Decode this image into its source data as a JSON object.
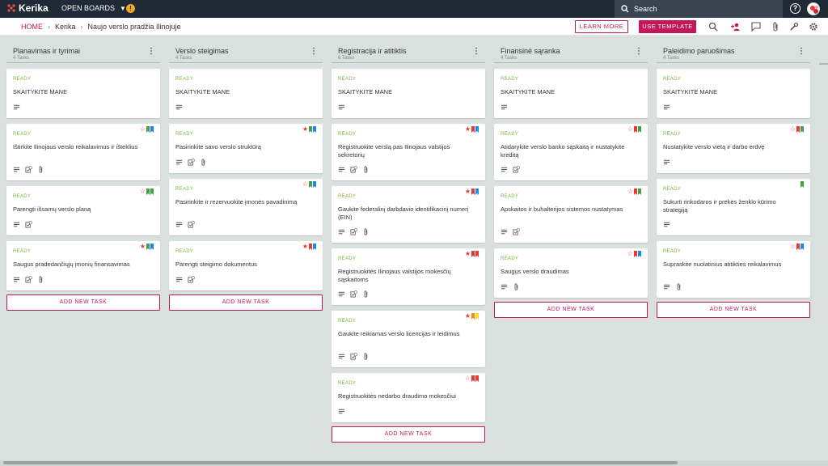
{
  "topbar": {
    "brand": "Kerika",
    "open_boards": "OPEN BOARDS",
    "alert_count": "!",
    "search_placeholder": "Search",
    "help": "?"
  },
  "subbar": {
    "breadcrumb": [
      "HOME",
      "Kerika",
      "Naujo verslo pradžia Ilinojuje"
    ],
    "learn_more": "LEARN MORE",
    "use_template": "USE TEMPLATE"
  },
  "colors": {
    "accent": "#c2185b",
    "ready": "#7cb342",
    "topbar": "#1f2a36"
  },
  "columns": [
    {
      "title": "Planavimas ir tyrimai",
      "count": "4 Tasks",
      "add": "ADD NEW TASK",
      "cards": [
        {
          "status": "READY",
          "title": "SKAITYKITE MANE",
          "icons": [
            "desc"
          ],
          "flags": []
        },
        {
          "status": "READY",
          "title": "Ištirkite Ilinojaus verslo reikalavimus ir išteklius",
          "icons": [
            "desc",
            "check",
            "attach"
          ],
          "flags": [
            "star-o",
            "green",
            "blue"
          ]
        },
        {
          "status": "READY",
          "title": "Parengti išsamų verslo planą",
          "icons": [
            "desc",
            "check"
          ],
          "flags": [
            "star-o",
            "green",
            "green"
          ]
        },
        {
          "status": "READY",
          "title": "Saugus pradedančiųjų įmonių finansavimas",
          "icons": [
            "desc",
            "check",
            "attach"
          ],
          "flags": [
            "star",
            "green",
            "blue"
          ]
        }
      ]
    },
    {
      "title": "Verslo steigimas",
      "count": "4 Tasks",
      "add": "ADD NEW TASK",
      "cards": [
        {
          "status": "READY",
          "title": "SKAITYKITE MANE",
          "icons": [
            "desc"
          ],
          "flags": []
        },
        {
          "status": "READY",
          "title": "Pasirinkite savo verslo struktūrą",
          "icons": [
            "desc",
            "check",
            "attach"
          ],
          "flags": [
            "star",
            "green",
            "blue"
          ]
        },
        {
          "status": "READY",
          "title": "Pasirinkite ir rezervuokite įmonės pavadinimą",
          "icons": [
            "desc",
            "check"
          ],
          "flags": [
            "star-o",
            "green",
            "blue"
          ]
        },
        {
          "status": "READY",
          "title": "Parengti steigimo dokumentus",
          "icons": [
            "desc",
            "check"
          ],
          "flags": [
            "star",
            "red",
            "blue"
          ]
        }
      ]
    },
    {
      "title": "Registracija ir atitiktis",
      "count": "6 Tasks",
      "add": "ADD NEW TASK",
      "cards": [
        {
          "status": "READY",
          "title": "SKAITYKITE MANE",
          "icons": [
            "desc"
          ],
          "flags": []
        },
        {
          "status": "READY",
          "title": "Registruokite verslą pas Ilinojaus valstijos sekretorių",
          "icons": [
            "desc",
            "check",
            "attach"
          ],
          "flags": [
            "star",
            "red",
            "blue"
          ]
        },
        {
          "status": "READY",
          "title": "Gaukite federalinį darbdavio identifikacinį numerį (EIN)",
          "icons": [
            "desc",
            "check",
            "attach"
          ],
          "flags": [
            "star",
            "red",
            "blue"
          ]
        },
        {
          "status": "READY",
          "title": "Registruokitės Ilinojaus valstijos mokesčių sąskaitoms",
          "icons": [
            "desc",
            "check",
            "attach"
          ],
          "flags": [
            "star",
            "red",
            "red"
          ]
        },
        {
          "status": "READY",
          "title": "Gaukite reikiamas verslo licencijas ir leidimus",
          "icons": [
            "desc",
            "check",
            "attach"
          ],
          "flags": [
            "star",
            "orange",
            "yellow"
          ]
        },
        {
          "status": "READY",
          "title": "Registruokitės nedarbo draudimo mokesčiui",
          "icons": [
            "desc"
          ],
          "flags": [
            "star-o",
            "red",
            "red"
          ]
        }
      ]
    },
    {
      "title": "Finansinė sąranka",
      "count": "4 Tasks",
      "add": "ADD NEW TASK",
      "cards": [
        {
          "status": "READY",
          "title": "SKAITYKITE MANE",
          "icons": [
            "desc"
          ],
          "flags": []
        },
        {
          "status": "READY",
          "title": "Atidarykite verslo banko sąskaitą ir nustatykite kreditą",
          "icons": [
            "desc",
            "check"
          ],
          "flags": [
            "star-o",
            "red",
            "green"
          ]
        },
        {
          "status": "READY",
          "title": "Apskaitos ir buhalterijos sistemos nustatymas",
          "icons": [
            "desc",
            "check"
          ],
          "flags": [
            "star-o",
            "red",
            "green"
          ]
        },
        {
          "status": "READY",
          "title": "Saugus verslo draudimas",
          "icons": [
            "desc",
            "attach"
          ],
          "flags": [
            "star-o",
            "red",
            "blue"
          ]
        }
      ]
    },
    {
      "title": "Paleidimo paruošimas",
      "count": "4 Tasks",
      "add": "ADD NEW TASK",
      "cards": [
        {
          "status": "READY",
          "title": "SKAITYKITE MANE",
          "icons": [
            "desc"
          ],
          "flags": []
        },
        {
          "status": "READY",
          "title": "Nustatykite verslo vietą ir darbo erdvę",
          "icons": [
            "desc"
          ],
          "flags": [
            "star-o",
            "red",
            "green"
          ]
        },
        {
          "status": "READY",
          "title": "Sukurti rinkodaros ir prekės ženklo kūrimo strategiją",
          "icons": [
            "desc"
          ],
          "flags": [
            "green"
          ]
        },
        {
          "status": "READY",
          "title": "Supraskite nuolatinius atitikties reikalavimus",
          "icons": [
            "desc",
            "attach"
          ],
          "flags": [
            "star-o",
            "red",
            "blue"
          ]
        }
      ]
    }
  ]
}
